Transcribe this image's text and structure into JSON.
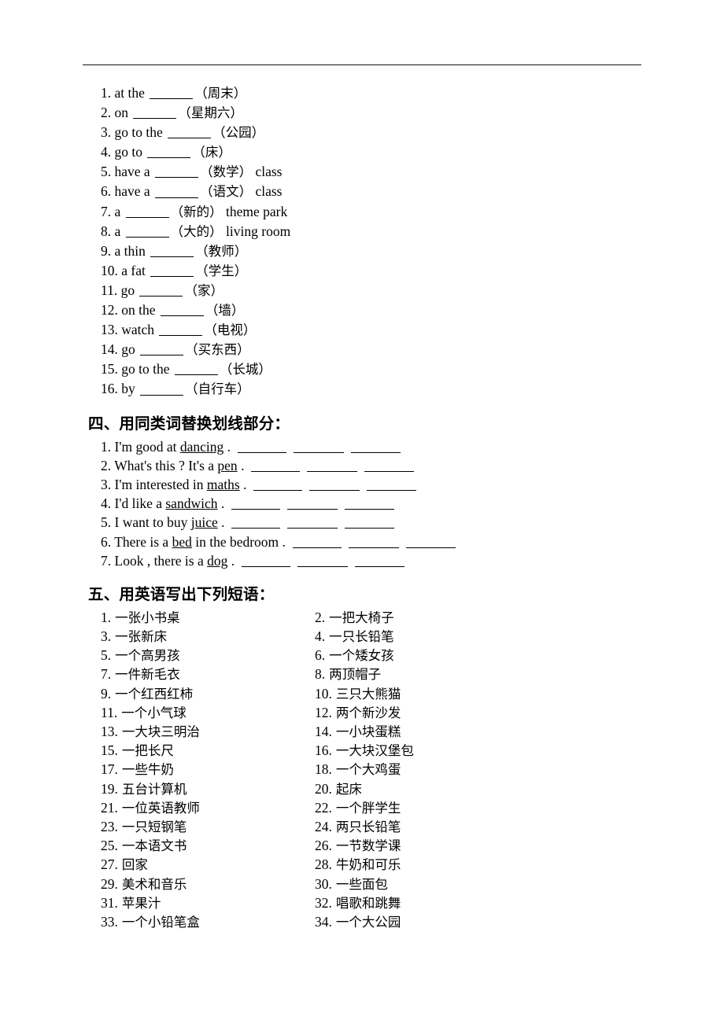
{
  "document": {
    "rule_present": true
  },
  "section_fill": {
    "items": [
      {
        "num": "1.",
        "pre": "at the",
        "post": "",
        "hint": "（周末）"
      },
      {
        "num": "2.",
        "pre": "on",
        "post": "",
        "hint": "（星期六）"
      },
      {
        "num": "3.",
        "pre": "go to the",
        "post": "",
        "hint": "（公园）"
      },
      {
        "num": "4.",
        "pre": "go to",
        "post": "",
        "hint": "（床）"
      },
      {
        "num": "5.",
        "pre": "have a",
        "post": "class",
        "hint": "（数学）"
      },
      {
        "num": "6.",
        "pre": "have a",
        "post": "class",
        "hint": "（语文）"
      },
      {
        "num": "7.",
        "pre": "a",
        "post": "theme park",
        "hint": "（新的）"
      },
      {
        "num": "8.",
        "pre": "a",
        "post": "living room",
        "hint": "（大的）"
      },
      {
        "num": "9.",
        "pre": "a thin",
        "post": "",
        "hint": "（教师）"
      },
      {
        "num": "10.",
        "pre": "a fat",
        "post": "",
        "hint": "（学生）"
      },
      {
        "num": "11.",
        "pre": "go",
        "post": "",
        "hint": "（家）"
      },
      {
        "num": "12.",
        "pre": "on the",
        "post": "",
        "hint": "（墙）"
      },
      {
        "num": "13.",
        "pre": "watch",
        "post": "",
        "hint": "（电视）"
      },
      {
        "num": "14.",
        "pre": "go",
        "post": "",
        "hint": "（买东西）"
      },
      {
        "num": "15.",
        "pre": "go to the",
        "post": "",
        "hint": "（长城）"
      },
      {
        "num": "16.",
        "pre": "by",
        "post": "",
        "hint": "（自行车）"
      }
    ]
  },
  "section_replace": {
    "heading": "四、用同类词替换划线部分：",
    "items": [
      {
        "num": "1.",
        "before": "I'm good at",
        "underlined": "dancing",
        "after": "."
      },
      {
        "num": "2.",
        "before": "What's this ? It's a",
        "underlined": "pen",
        "after": "."
      },
      {
        "num": "3.",
        "before": "I'm interested in",
        "underlined": "maths",
        "after": "."
      },
      {
        "num": "4.",
        "before": "I'd like a",
        "underlined": "sandwich",
        "after": "."
      },
      {
        "num": "5.",
        "before": "I want to buy",
        "underlined": "juice",
        "after": "."
      },
      {
        "num": "6.",
        "before": "There is a",
        "underlined": "bed",
        "after": "in the bedroom ."
      },
      {
        "num": "7.",
        "before": "Look , there is a",
        "underlined": "dog",
        "after": "."
      }
    ]
  },
  "section_phrases": {
    "heading": "五、用英语写出下列短语：",
    "rows": [
      {
        "left": {
          "num": "1.",
          "text": "一张小书桌"
        },
        "right": {
          "num": "2.",
          "text": "一把大椅子"
        }
      },
      {
        "left": {
          "num": "3.",
          "text": "一张新床"
        },
        "right": {
          "num": "4.",
          "text": "一只长铅笔"
        }
      },
      {
        "left": {
          "num": "5.",
          "text": "一个高男孩"
        },
        "right": {
          "num": "6.",
          "text": "一个矮女孩"
        }
      },
      {
        "left": {
          "num": "7.",
          "text": "一件新毛衣"
        },
        "right": {
          "num": "8.",
          "text": "两顶帽子"
        }
      },
      {
        "left": {
          "num": "9.",
          "text": "一个红西红柿"
        },
        "right": {
          "num": "10.",
          "text": "三只大熊猫"
        }
      },
      {
        "left": {
          "num": "11.",
          "text": "一个小气球"
        },
        "right": {
          "num": "12.",
          "text": "两个新沙发"
        }
      },
      {
        "left": {
          "num": "13.",
          "text": "一大块三明治"
        },
        "right": {
          "num": "14.",
          "text": "一小块蛋糕"
        }
      },
      {
        "left": {
          "num": "15.",
          "text": "一把长尺"
        },
        "right": {
          "num": "16.",
          "text": "一大块汉堡包"
        }
      },
      {
        "left": {
          "num": "17.",
          "text": "一些牛奶"
        },
        "right": {
          "num": "18.",
          "text": "一个大鸡蛋"
        }
      },
      {
        "left": {
          "num": "19.",
          "text": "五台计算机"
        },
        "right": {
          "num": "20.",
          "text": "起床"
        }
      },
      {
        "left": {
          "num": "21.",
          "text": "一位英语教师"
        },
        "right": {
          "num": "22.",
          "text": "一个胖学生"
        }
      },
      {
        "left": {
          "num": "23.",
          "text": "一只短钢笔"
        },
        "right": {
          "num": "24.",
          "text": "两只长铅笔"
        }
      },
      {
        "left": {
          "num": "25.",
          "text": "一本语文书"
        },
        "right": {
          "num": "26.",
          "text": "一节数学课"
        }
      },
      {
        "left": {
          "num": "27.",
          "text": "回家"
        },
        "right": {
          "num": "28.",
          "text": "牛奶和可乐"
        }
      },
      {
        "left": {
          "num": "29.",
          "text": "美术和音乐"
        },
        "right": {
          "num": "30.",
          "text": "一些面包"
        }
      },
      {
        "left": {
          "num": "31.",
          "text": "苹果汁"
        },
        "right": {
          "num": "32.",
          "text": "唱歌和跳舞"
        }
      },
      {
        "left": {
          "num": "33.",
          "text": "一个小铅笔盒"
        },
        "right": {
          "num": "34.",
          "text": "一个大公园"
        }
      }
    ]
  }
}
